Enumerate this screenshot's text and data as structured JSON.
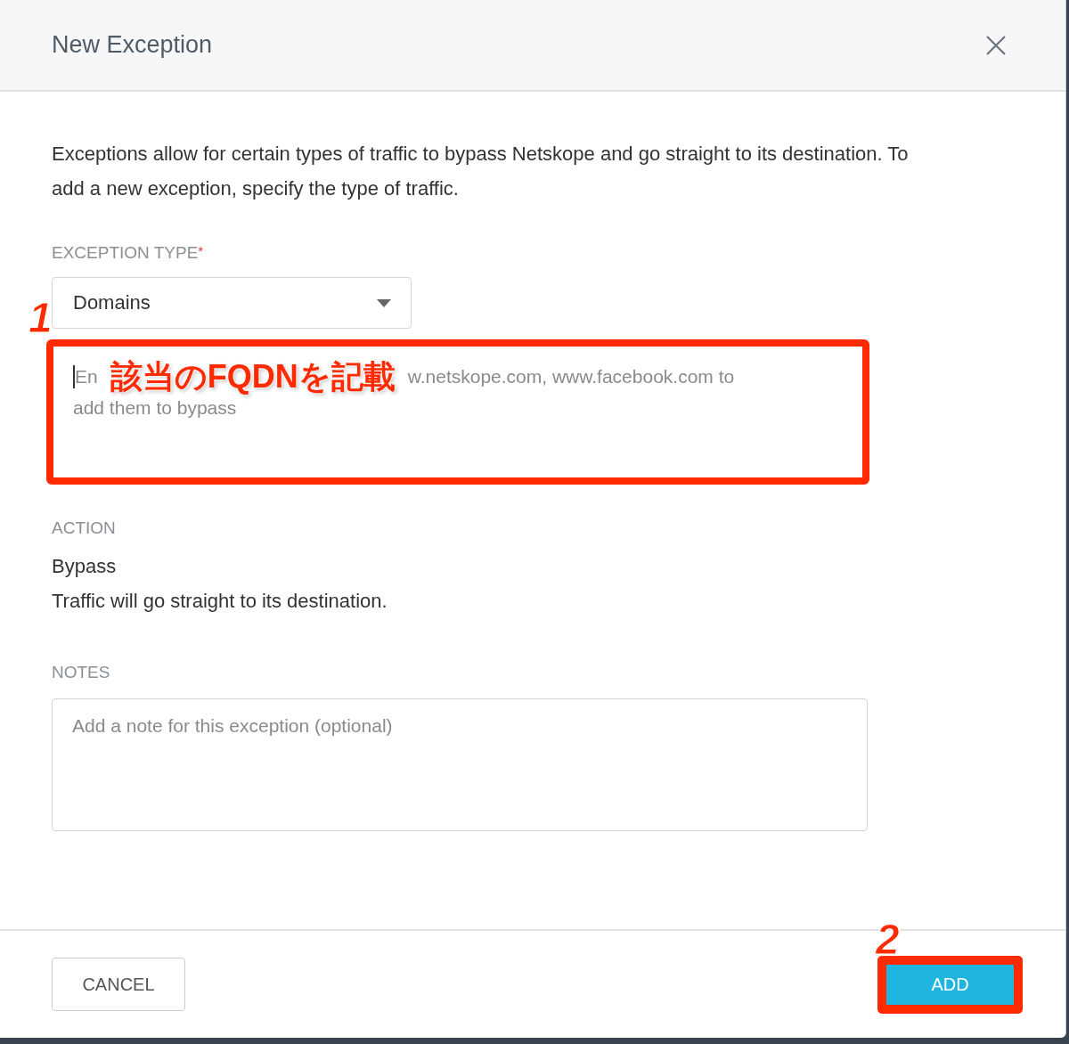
{
  "dialog": {
    "title": "New Exception"
  },
  "intro": "Exceptions allow for certain types of traffic to bypass Netskope and go straight to its destination. To add a new exception, specify the type of traffic.",
  "exception_type": {
    "label": "EXCEPTION TYPE",
    "required_mark": "*",
    "value": "Domains"
  },
  "domains_field": {
    "placeholder_fragments": [
      "En",
      "w.netskope.com, www.facebook.com to",
      "add them to bypass"
    ]
  },
  "action": {
    "label": "ACTION",
    "value": "Bypass",
    "description": "Traffic will go straight to its destination."
  },
  "notes": {
    "label": "NOTES",
    "placeholder": "Add a note for this exception (optional)"
  },
  "buttons": [
    {
      "label": "CANCEL",
      "kind": "secondary"
    },
    {
      "label": "ADD",
      "kind": "primary"
    }
  ],
  "annotations": [
    {
      "number": "1",
      "text": "該当のFQDNを記載"
    },
    {
      "number": "2"
    }
  ]
}
